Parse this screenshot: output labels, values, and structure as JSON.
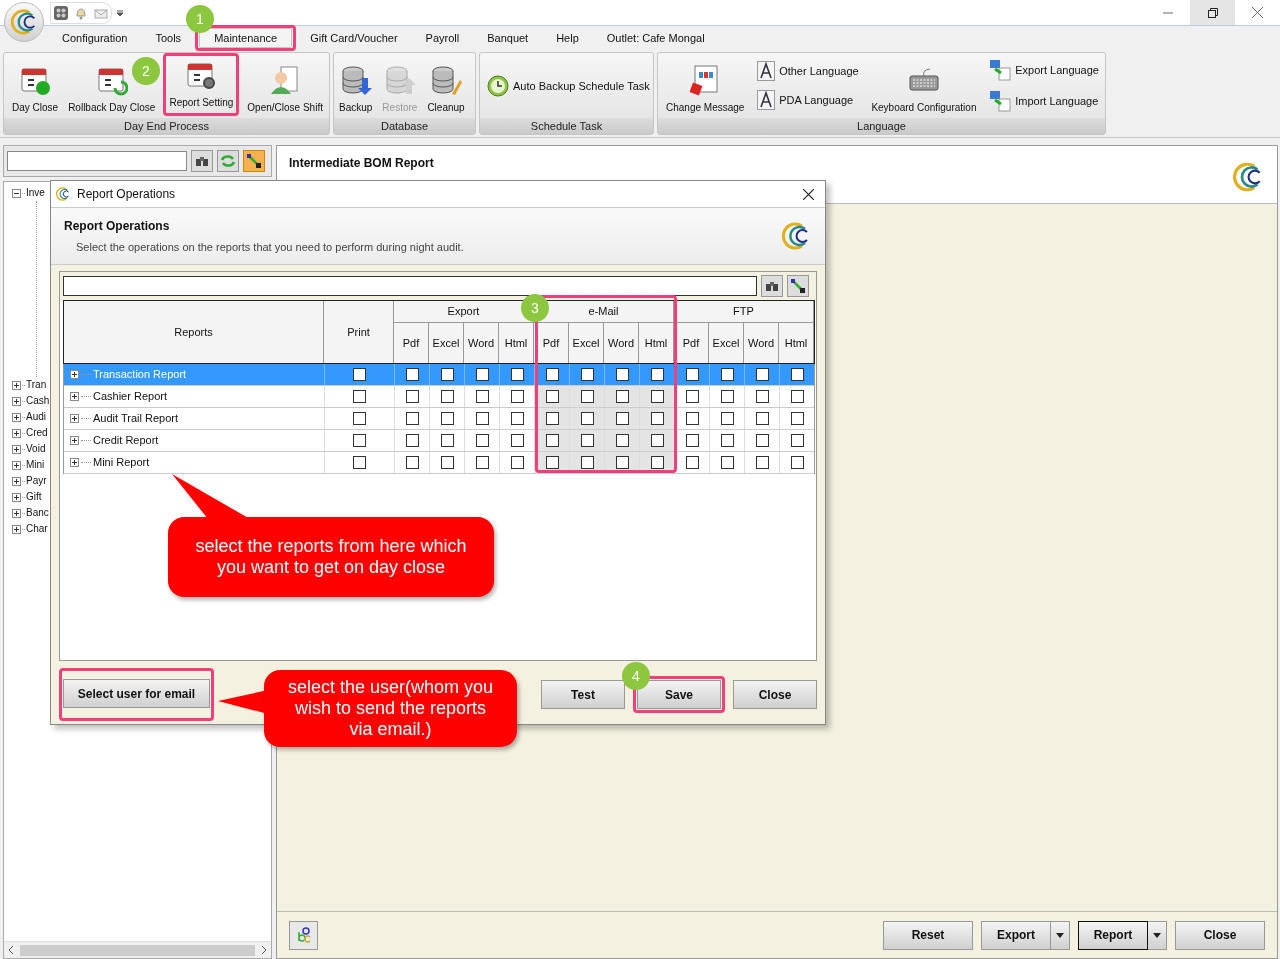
{
  "menu_tabs": [
    {
      "label": "Configuration",
      "selected": false
    },
    {
      "label": "Tools",
      "selected": false
    },
    {
      "label": "Maintenance",
      "selected": true,
      "highlighted": true
    },
    {
      "label": "Gift Card/Voucher",
      "selected": false
    },
    {
      "label": "Payroll",
      "selected": false
    },
    {
      "label": "Banquet",
      "selected": false
    },
    {
      "label": "Help",
      "selected": false
    },
    {
      "label": "Outlet: Cafe Mongal",
      "selected": false
    }
  ],
  "ribbon_groups": [
    {
      "title": "Day End Process",
      "buttons": [
        {
          "label": "Day Close",
          "kind": "large",
          "disabled": false
        },
        {
          "label": "Rollback Day Close",
          "kind": "large",
          "disabled": false
        },
        {
          "label": "Report Setting",
          "kind": "large",
          "disabled": false,
          "highlighted": true
        },
        {
          "label": "Open/Close Shift",
          "kind": "large",
          "disabled": false
        }
      ]
    },
    {
      "title": "Database",
      "buttons": [
        {
          "label": "Backup",
          "kind": "large",
          "disabled": false
        },
        {
          "label": "Restore",
          "kind": "large",
          "disabled": true
        },
        {
          "label": "Cleanup",
          "kind": "large",
          "disabled": false
        }
      ]
    },
    {
      "title": "Schedule Task",
      "buttons": [
        {
          "label": "Auto Backup Schedule Task",
          "kind": "inline",
          "disabled": false
        }
      ]
    },
    {
      "title": "Language",
      "buttons": [
        {
          "label": "Change Message",
          "kind": "large",
          "disabled": false
        },
        {
          "label": "Other Language",
          "kind": "small",
          "disabled": false
        },
        {
          "label": "PDA Language",
          "kind": "small",
          "disabled": false
        },
        {
          "label": "Keyboard Configuration",
          "kind": "large",
          "disabled": false
        },
        {
          "label": "Export Language",
          "kind": "small",
          "disabled": false
        },
        {
          "label": "Import Language",
          "kind": "small",
          "disabled": false
        }
      ]
    }
  ],
  "tree": [
    {
      "label": "Inve",
      "expanded": true
    },
    {
      "label": "Tran",
      "expanded": false
    },
    {
      "label": "Cash",
      "expanded": false
    },
    {
      "label": "Audi",
      "expanded": false
    },
    {
      "label": "Cred",
      "expanded": false
    },
    {
      "label": "Void",
      "expanded": false
    },
    {
      "label": "Mini",
      "expanded": false
    },
    {
      "label": "Payr",
      "expanded": false
    },
    {
      "label": "Gift",
      "expanded": false
    },
    {
      "label": "Banc",
      "expanded": false
    },
    {
      "label": "Char",
      "expanded": false
    }
  ],
  "report_panel": {
    "title": "Intermediate BOM Report",
    "buttons": [
      {
        "label": "Reset",
        "dropdown": false,
        "focused": false
      },
      {
        "label": "Export",
        "dropdown": true,
        "focused": false
      },
      {
        "label": "Report",
        "dropdown": true,
        "focused": true
      },
      {
        "label": "Close",
        "dropdown": false,
        "focused": false
      }
    ]
  },
  "dialog": {
    "title": "Report Operations",
    "heading": "Report Operations",
    "description": "Select the operations on the reports that you need to perform during night audit.",
    "columns": {
      "reports": "Reports",
      "print": "Print",
      "groups": [
        {
          "label": "Export",
          "subs": [
            "Pdf",
            "Excel",
            "Word",
            "Html"
          ]
        },
        {
          "label": "e-Mail",
          "subs": [
            "Pdf",
            "Excel",
            "Word",
            "Html"
          ]
        },
        {
          "label": "FTP",
          "subs": [
            "Pdf",
            "Excel",
            "Word",
            "Html"
          ]
        }
      ]
    },
    "rows": [
      {
        "name": "Transaction Report",
        "selected": true,
        "checks": [
          false,
          false,
          false,
          false,
          false,
          false,
          false,
          false,
          false,
          false,
          false,
          false,
          false
        ]
      },
      {
        "name": "Cashier Report",
        "selected": false,
        "checks": [
          false,
          false,
          false,
          false,
          false,
          false,
          false,
          false,
          false,
          false,
          false,
          false,
          false
        ]
      },
      {
        "name": "Audit Trail Report",
        "selected": false,
        "checks": [
          false,
          false,
          false,
          false,
          false,
          false,
          false,
          false,
          false,
          false,
          false,
          false,
          false
        ]
      },
      {
        "name": "Credit Report",
        "selected": false,
        "checks": [
          false,
          false,
          false,
          false,
          false,
          false,
          false,
          false,
          false,
          false,
          false,
          false,
          false
        ]
      },
      {
        "name": "Mini Report",
        "selected": false,
        "checks": [
          false,
          false,
          false,
          false,
          false,
          false,
          false,
          false,
          false,
          false,
          false,
          false,
          false
        ]
      }
    ],
    "buttons": [
      {
        "label": "Select user for email",
        "highlighted": true
      },
      {
        "label": "Test"
      },
      {
        "label": "Save",
        "highlighted": true
      },
      {
        "label": "Close"
      }
    ]
  },
  "annotations": {
    "steps": [
      "1",
      "2",
      "3",
      "4"
    ],
    "callouts": [
      "select the reports from here which you want to get on day close",
      "select the user(whom you wish to send the reports via email.)"
    ]
  }
}
